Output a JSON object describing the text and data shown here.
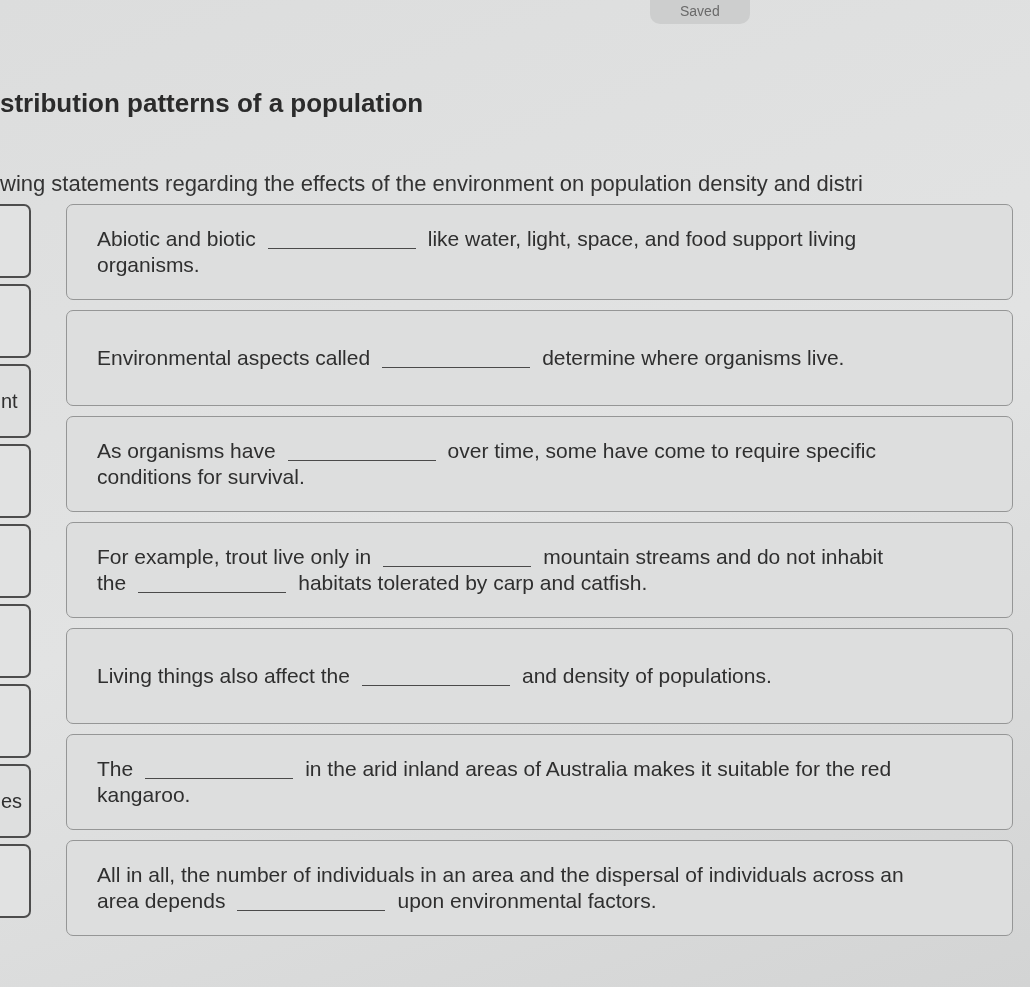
{
  "status_badge": {
    "text": "Saved"
  },
  "title": "stribution patterns of a population",
  "instructions": "wing statements regarding the effects of the environment on population density and distri",
  "answer_tiles": [
    {
      "kind": "empty"
    },
    {
      "kind": "empty"
    },
    {
      "kind": "word",
      "text": "nt"
    },
    {
      "kind": "empty"
    },
    {
      "kind": "empty"
    },
    {
      "kind": "empty"
    },
    {
      "kind": "empty"
    },
    {
      "kind": "word",
      "text": "es"
    },
    {
      "kind": "empty"
    }
  ],
  "statements": [
    {
      "parts": [
        {
          "kind": "text",
          "text": "Abiotic and biotic"
        },
        {
          "kind": "blank"
        },
        {
          "kind": "text",
          "text": "like water, light, space, and food support living"
        },
        {
          "kind": "text",
          "text": "organisms."
        }
      ]
    },
    {
      "parts": [
        {
          "kind": "text",
          "text": "Environmental aspects called"
        },
        {
          "kind": "blank"
        },
        {
          "kind": "text",
          "text": "determine where organisms live."
        }
      ]
    },
    {
      "parts": [
        {
          "kind": "text",
          "text": "As organisms have"
        },
        {
          "kind": "blank"
        },
        {
          "kind": "text",
          "text": "over time, some have come to require specific"
        },
        {
          "kind": "text",
          "text": "conditions for survival."
        }
      ]
    },
    {
      "parts": [
        {
          "kind": "text",
          "text": "For example, trout live only in"
        },
        {
          "kind": "blank"
        },
        {
          "kind": "text",
          "text": "mountain streams and do not inhabit"
        },
        {
          "kind": "text",
          "text": "the"
        },
        {
          "kind": "blank"
        },
        {
          "kind": "text",
          "text": "habitats tolerated by carp and catfish."
        }
      ]
    },
    {
      "parts": [
        {
          "kind": "text",
          "text": "Living things also affect the"
        },
        {
          "kind": "blank"
        },
        {
          "kind": "text",
          "text": "and density of populations."
        }
      ]
    },
    {
      "parts": [
        {
          "kind": "text",
          "text": "The"
        },
        {
          "kind": "blank"
        },
        {
          "kind": "text",
          "text": "in the arid inland areas of Australia makes it suitable for the red"
        },
        {
          "kind": "text",
          "text": "kangaroo."
        }
      ]
    },
    {
      "parts": [
        {
          "kind": "text",
          "text": "All in all, the number of individuals in an area and the dispersal of individuals across an"
        },
        {
          "kind": "text",
          "text": "area depends"
        },
        {
          "kind": "blank"
        },
        {
          "kind": "text",
          "text": "upon environmental factors."
        }
      ]
    }
  ]
}
